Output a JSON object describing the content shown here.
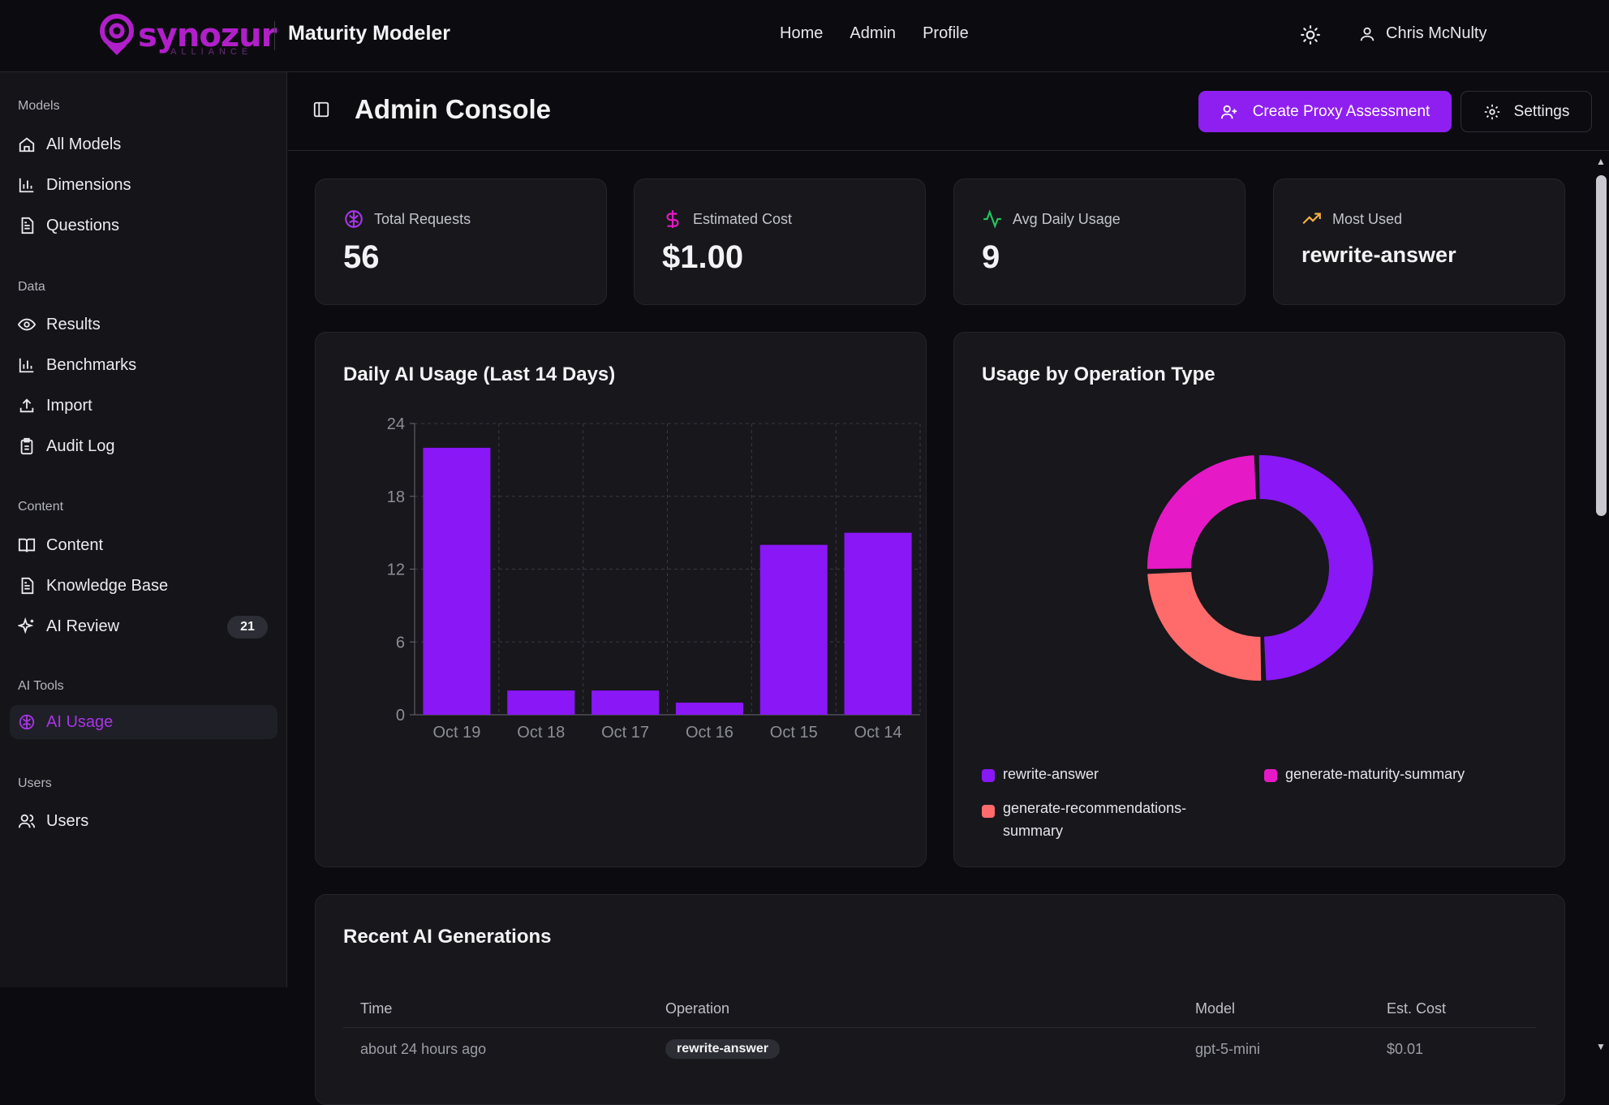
{
  "topbar": {
    "logo_text": "synozur",
    "logo_subtext": "ALLIANCE",
    "app_title": "Maturity Modeler",
    "nav": [
      "Home",
      "Admin",
      "Profile"
    ],
    "user_name": "Chris McNulty"
  },
  "sidebar": {
    "groups": {
      "models": "Models",
      "data": "Data",
      "content": "Content",
      "ai_tools": "AI Tools",
      "users": "Users"
    },
    "items": {
      "all_models": "All Models",
      "dimensions": "Dimensions",
      "questions": "Questions",
      "results": "Results",
      "benchmarks": "Benchmarks",
      "import": "Import",
      "audit_log": "Audit Log",
      "content": "Content",
      "knowledge_base": "Knowledge Base",
      "ai_review": "AI Review",
      "ai_review_badge": "21",
      "ai_usage": "AI Usage",
      "users": "Users"
    }
  },
  "header": {
    "title": "Admin Console",
    "create_button": "Create Proxy Assessment",
    "settings_button": "Settings"
  },
  "stats": [
    {
      "label": "Total Requests",
      "value": "56",
      "icon": "brain-icon"
    },
    {
      "label": "Estimated Cost",
      "value": "$1.00",
      "icon": "dollar-icon"
    },
    {
      "label": "Avg Daily Usage",
      "value": "9",
      "icon": "activity-icon"
    },
    {
      "label": "Most Used",
      "value": "rewrite-answer",
      "icon": "trending-up-icon"
    }
  ],
  "chart_data": [
    {
      "type": "bar",
      "title": "Daily AI Usage (Last 14 Days)",
      "categories": [
        "Oct 19",
        "Oct 18",
        "Oct 17",
        "Oct 16",
        "Oct 15",
        "Oct 14"
      ],
      "values": [
        22,
        2,
        2,
        1,
        14,
        15
      ],
      "ylim": [
        0,
        24
      ],
      "yticks": [
        "0",
        "6",
        "12",
        "18",
        "24"
      ],
      "grid": true,
      "color": "#8a17f5"
    },
    {
      "type": "pie",
      "title": "Usage by Operation Type",
      "labels": [
        "rewrite-answer",
        "generate-recommendations-summary",
        "generate-maturity-summary"
      ],
      "values": [
        50,
        25,
        25
      ],
      "colors": [
        "#8a17f5",
        "#ff6b6b",
        "#e619c6"
      ],
      "legend_labels": [
        "rewrite-answer",
        "generate-maturity-summary",
        "generate-recommendations-summary"
      ],
      "legend_colors": [
        "#8a17f5",
        "#e619c6",
        "#ff6b6b"
      ],
      "legend": "bottom"
    }
  ],
  "recent": {
    "title": "Recent AI Generations",
    "columns": [
      "Time",
      "Operation",
      "Model",
      "Est. Cost"
    ],
    "rows": [
      {
        "time": "about 24 hours ago",
        "operation": "rewrite-answer",
        "model": "gpt-5-mini",
        "cost": "$0.01"
      }
    ]
  }
}
